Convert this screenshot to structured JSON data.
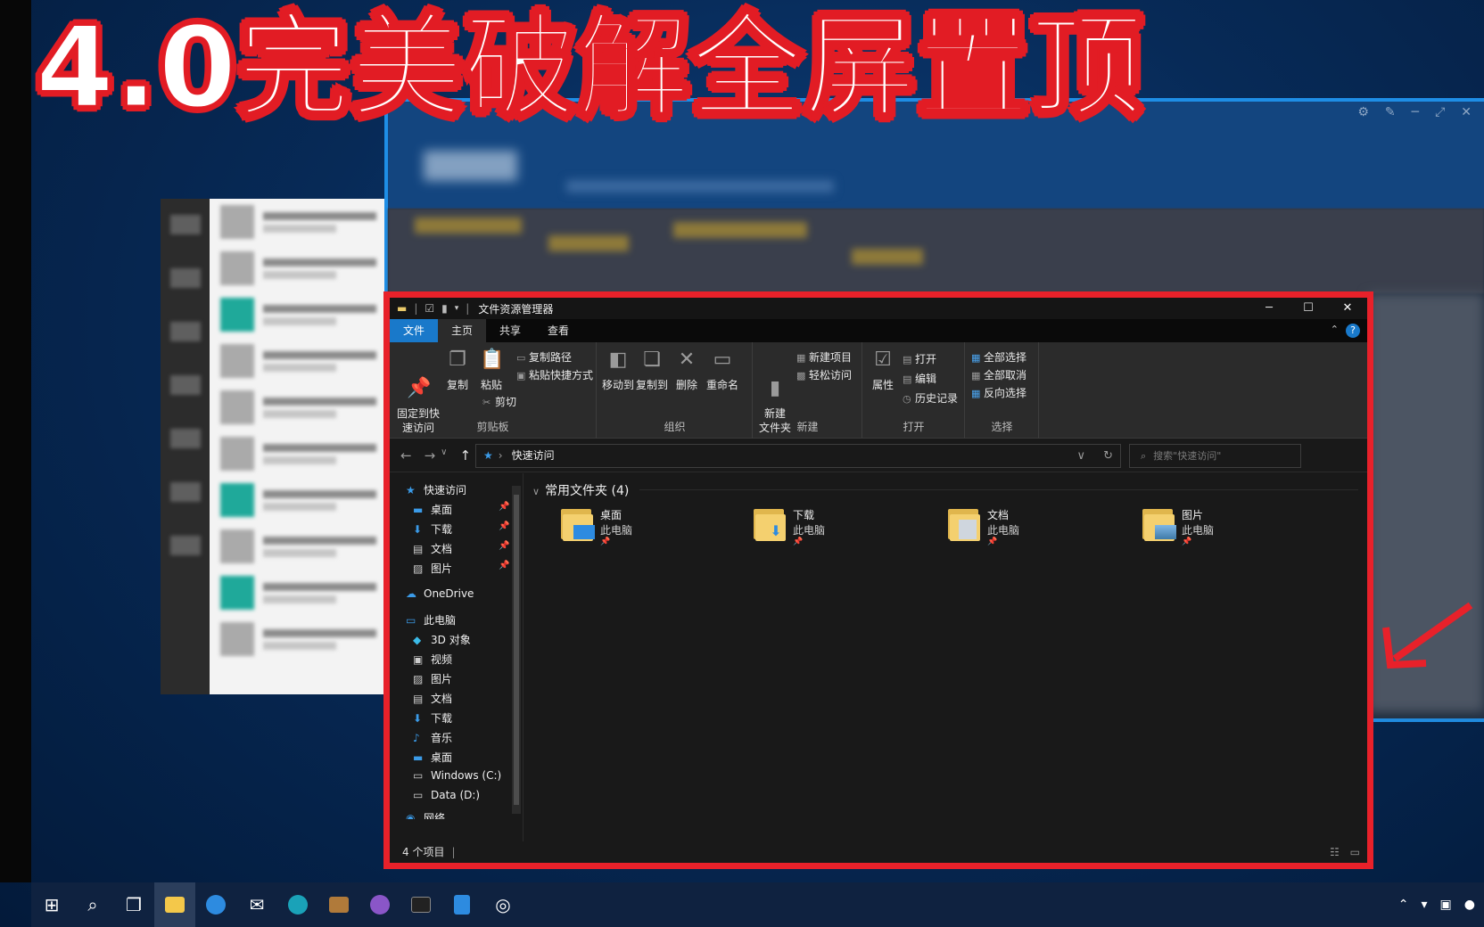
{
  "overlay": {
    "headline": "4.0完美破解全屏置顶"
  },
  "explorer": {
    "title": "文件资源管理器",
    "window_controls": {
      "minimize": "─",
      "maximize": "☐",
      "close": "✕"
    },
    "tabs": [
      {
        "label": "文件"
      },
      {
        "label": "主页"
      },
      {
        "label": "共享"
      },
      {
        "label": "查看"
      }
    ],
    "ribbon": {
      "clipboard": {
        "label": "剪贴板",
        "pin": "固定到快\n速访问",
        "copy": "复制",
        "paste": "粘贴",
        "copy_path": "复制路径",
        "paste_shortcut": "粘贴快捷方式",
        "cut": "剪切"
      },
      "organize": {
        "label": "组织",
        "move_to": "移动到",
        "copy_to": "复制到",
        "delete": "删除",
        "rename": "重命名"
      },
      "new": {
        "label": "新建",
        "new_folder": "新建\n文件夹",
        "new_item": "新建项目",
        "easy_access": "轻松访问"
      },
      "open": {
        "label": "打开",
        "properties": "属性",
        "open": "打开",
        "edit": "编辑",
        "history": "历史记录"
      },
      "select": {
        "label": "选择",
        "select_all": "全部选择",
        "select_none": "全部取消",
        "invert": "反向选择"
      }
    },
    "address": {
      "path": "快速访问"
    },
    "search": {
      "placeholder": "搜索\"快速访问\""
    },
    "nav": {
      "quick_access": "快速访问",
      "qa_items": [
        "桌面",
        "下载",
        "文档",
        "图片"
      ],
      "onedrive": "OneDrive",
      "this_pc": "此电脑",
      "pc_items": [
        "3D 对象",
        "视频",
        "图片",
        "文档",
        "下载",
        "音乐",
        "桌面",
        "Windows (C:)",
        "Data (D:)"
      ],
      "network": "网络"
    },
    "section": {
      "title": "常用文件夹 (4)"
    },
    "folders": [
      {
        "name": "桌面",
        "location": "此电脑",
        "icon": "desktop-folder-icon"
      },
      {
        "name": "下载",
        "location": "此电脑",
        "icon": "downloads-folder-icon"
      },
      {
        "name": "文档",
        "location": "此电脑",
        "icon": "documents-folder-icon"
      },
      {
        "name": "图片",
        "location": "此电脑",
        "icon": "pictures-folder-icon"
      }
    ],
    "status": {
      "count": "4 个项目"
    }
  },
  "taskbar": {
    "icons": [
      "windows-start-icon",
      "search-icon",
      "task-view-icon",
      "file-explorer-icon",
      "app-v-icon",
      "mail-icon",
      "edge-icon",
      "box-icon",
      "app-stripe-icon",
      "terminal-icon",
      "calculator-icon",
      "camera-icon"
    ]
  },
  "colors": {
    "accent": "#1979ca",
    "highlight_border": "#e8212a",
    "overlay_text_stroke": "#e21c24"
  }
}
